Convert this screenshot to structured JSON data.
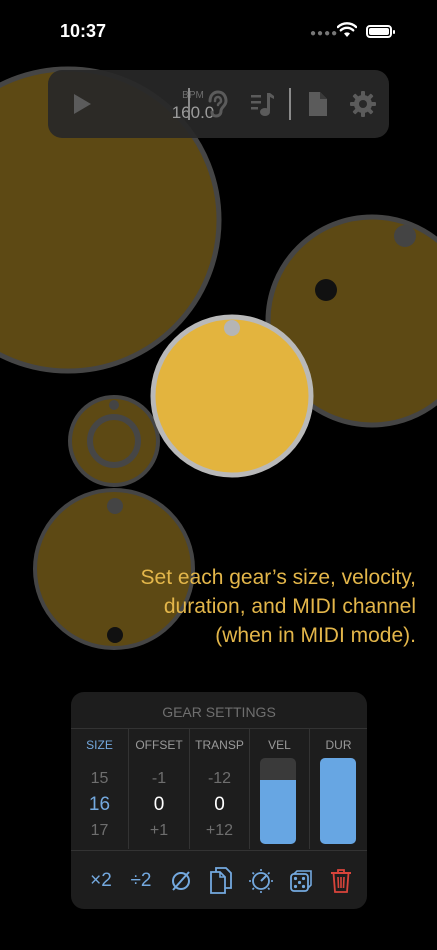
{
  "status_bar": {
    "time": "10:37"
  },
  "toolbar": {
    "bpm_label": "BPM",
    "bpm_value": "160.0"
  },
  "hint_text": {
    "line1": "Set each gear’s size, velocity,",
    "line2": "duration, and MIDI channel",
    "line3": "(when in MIDI mode)."
  },
  "gear_settings": {
    "title": "GEAR SETTINGS",
    "columns": {
      "size": {
        "label": "SIZE",
        "prev": "15",
        "current": "16",
        "next": "17"
      },
      "offset": {
        "label": "OFFSET",
        "prev": "-1",
        "current": "0",
        "next": "+1"
      },
      "transp": {
        "label": "TRANSP",
        "prev": "-12",
        "current": "0",
        "next": "+12"
      },
      "vel": {
        "label": "VEL",
        "level": 0.75
      },
      "dur": {
        "label": "DUR",
        "level": 1.0
      }
    },
    "actions": {
      "double": "×2",
      "halve": "÷2"
    }
  },
  "colors": {
    "gear_selected": "#e3b43e",
    "gear_dim": "#5d4914",
    "gear_rim": "#454545",
    "accent_blue": "#74a9df",
    "delete_red": "#d9443b",
    "hint_text": "#e3b64a"
  },
  "icons": [
    "play-icon",
    "ear-icon",
    "music-note-icon",
    "document-icon",
    "gear-icon",
    "empty-set-icon",
    "copy-icon",
    "randomize-dial-icon",
    "dice-icon",
    "trash-icon"
  ]
}
